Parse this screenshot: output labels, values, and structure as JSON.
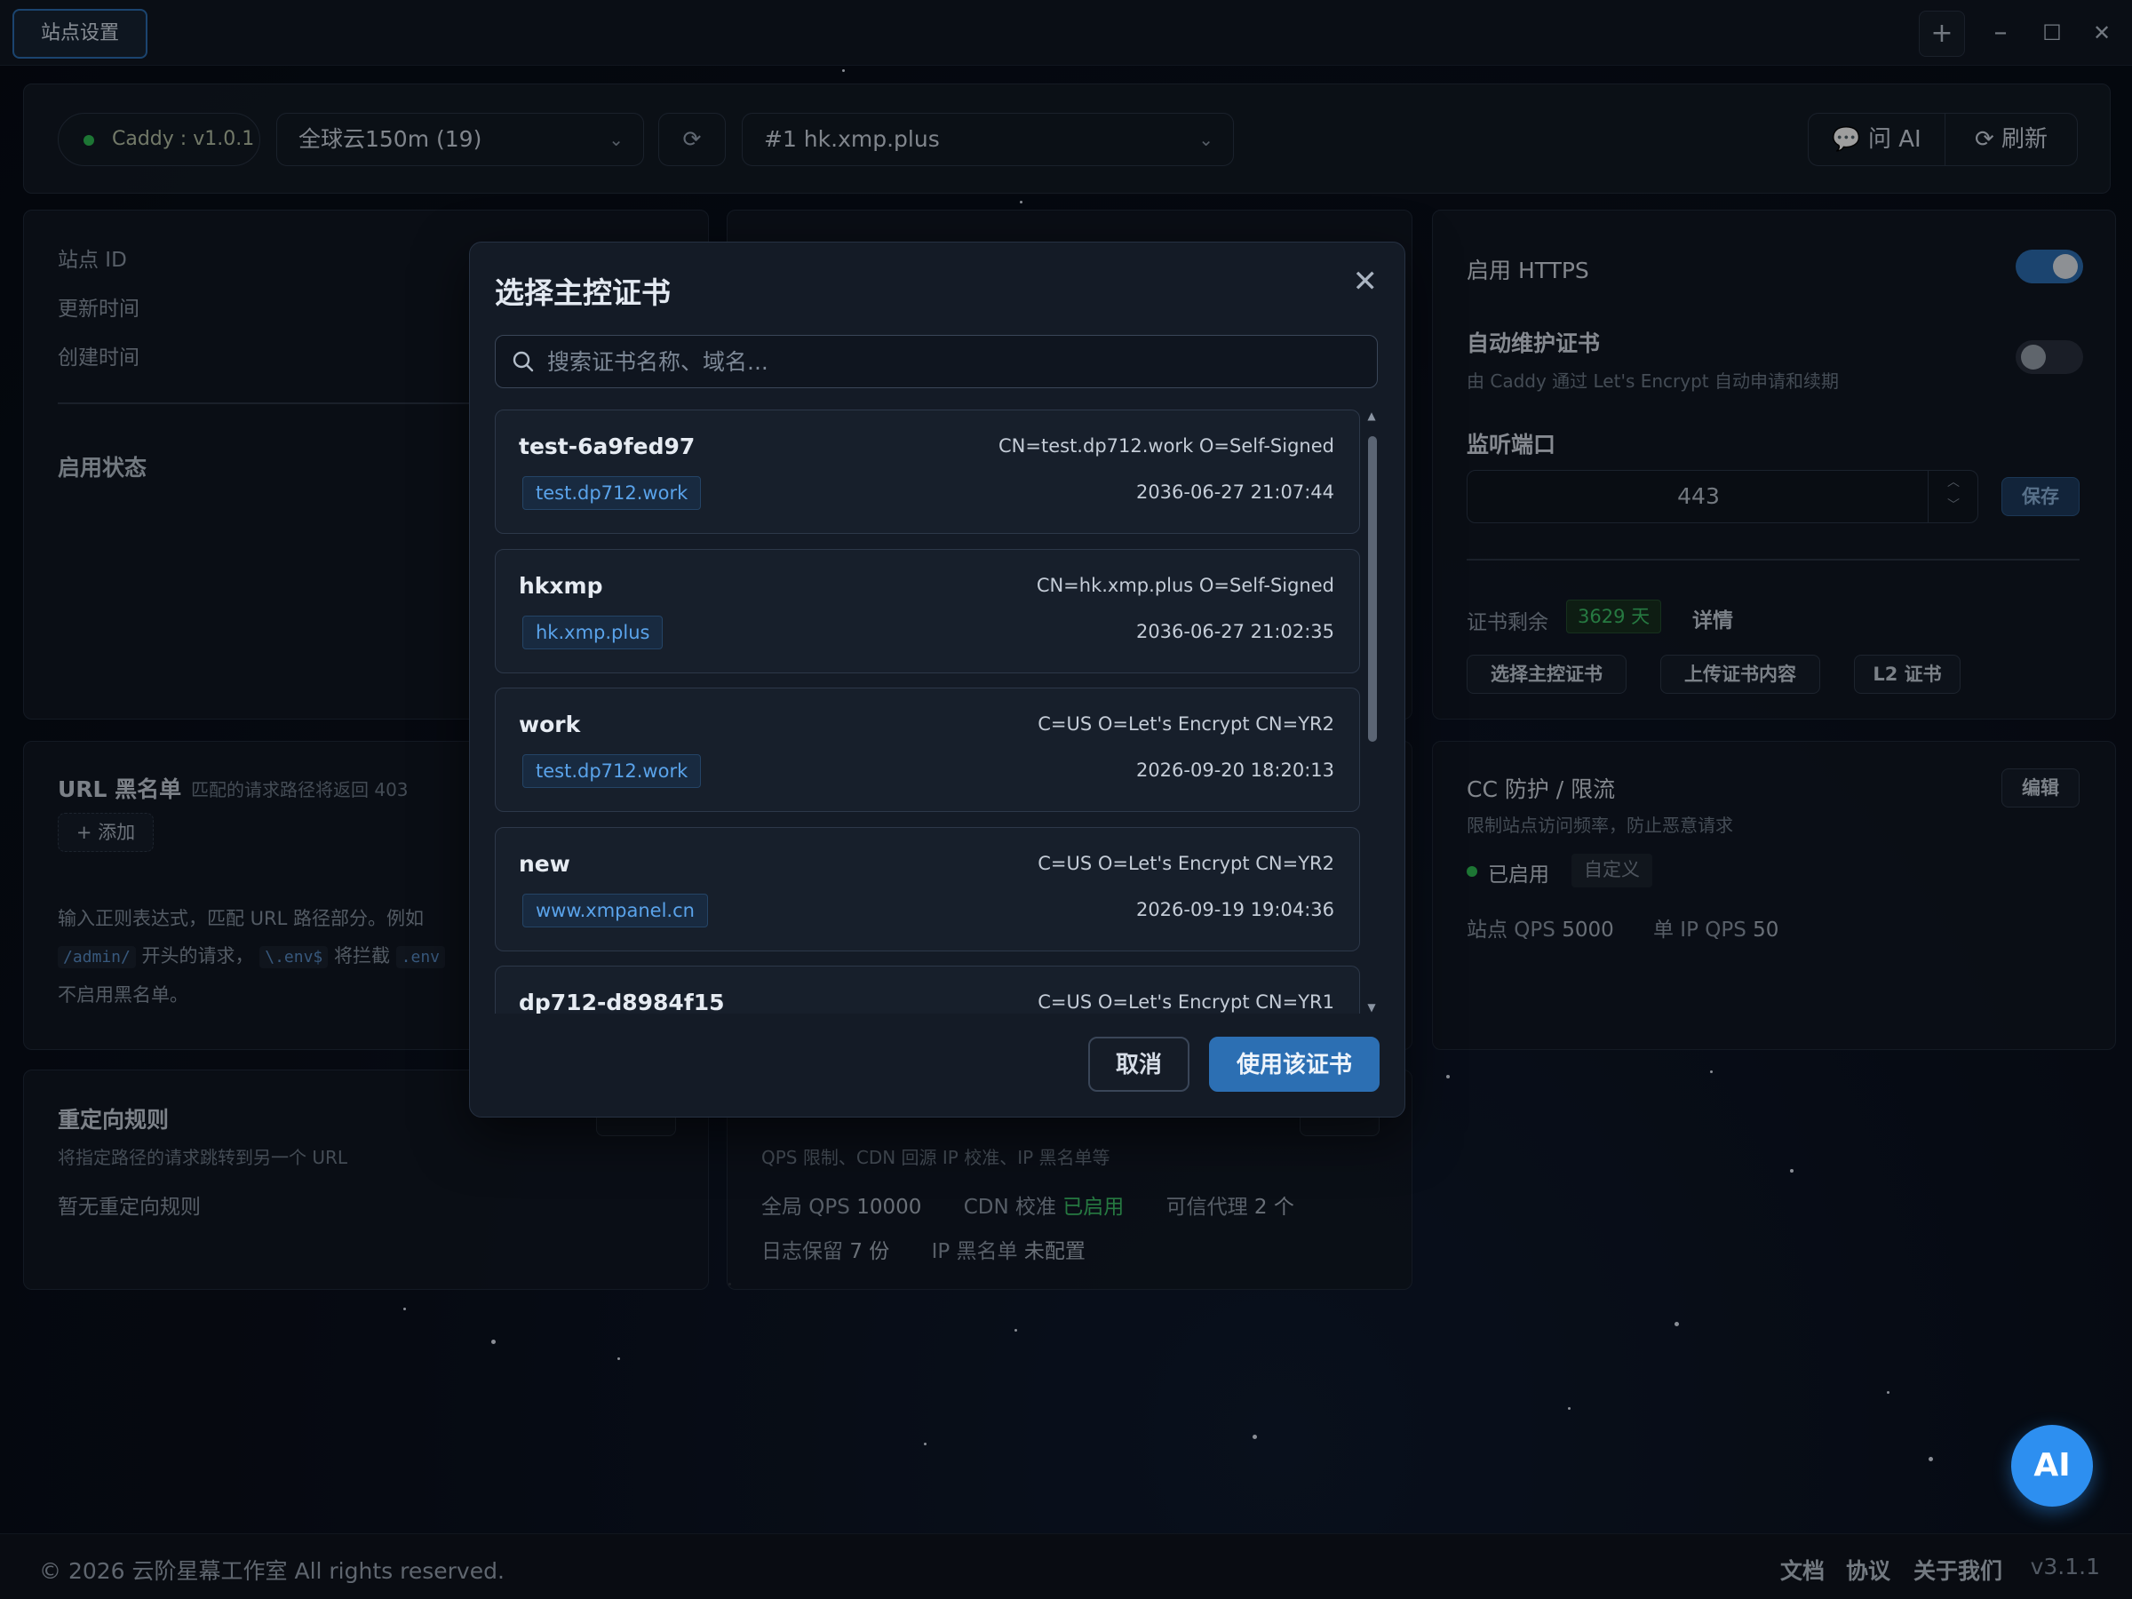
{
  "window": {
    "tab_title": "站点设置",
    "controls": {
      "new": "+",
      "minimize": "–",
      "maximize": "☐",
      "close": "✕"
    }
  },
  "toolbar": {
    "caddy_label": "Caddy : v1.0.1",
    "server_select": "全球云150m (19)",
    "site_select": "#1 hk.xmp.plus",
    "ask_ai": "问 AI",
    "refresh": "刷新"
  },
  "info_card": {
    "site_id_label": "站点 ID",
    "updated_label": "更新时间",
    "created_label": "创建时间",
    "enable_status_label": "启用状态"
  },
  "url_blacklist": {
    "title": "URL 黑名单",
    "subtitle": "匹配的请求路径将返回 403",
    "add_button": "+ 添加",
    "desc_line1": "输入正则表达式，匹配 URL 路径部分。例如",
    "desc_code1": "/admin/",
    "desc_text2": "开头的请求，",
    "desc_code2": "\\.env$",
    "desc_text3": "将拦截",
    "desc_code3": ".env",
    "desc_line3": "不启用黑名单。"
  },
  "redirect": {
    "title": "重定向规则",
    "subtitle": "将指定路径的请求跳转到另一个 URL",
    "empty": "暂无重定向规则"
  },
  "global_card": {
    "subtitle": "QPS 限制、CDN 回源 IP 校准、IP 黑名单等",
    "global_qps_label": "全局 QPS",
    "global_qps_value": "10000",
    "cdn_label": "CDN 校准",
    "cdn_value": "已启用",
    "trusted_label": "可信代理",
    "trusted_value": "2 个",
    "log_label": "日志保留",
    "log_value": "7 份",
    "ipbl_label": "IP 黑名单",
    "ipbl_value": "未配置"
  },
  "https_card": {
    "enable_https_label": "启用 HTTPS",
    "enable_https_on": true,
    "auto_cert_label": "自动维护证书",
    "auto_cert_desc": "由 Caddy 通过 Let's Encrypt 自动申请和续期",
    "auto_cert_on": false,
    "port_label": "监听端口",
    "port_value": "443",
    "save_button": "保存",
    "cert_remaining_label": "证书剩余",
    "cert_remaining_value": "3629 天",
    "details_link": "详情",
    "select_master_button": "选择主控证书",
    "upload_button": "上传证书内容",
    "l2_button": "L2 证书"
  },
  "cc_card": {
    "title": "CC 防护 / 限流",
    "edit_button": "编辑",
    "subtitle": "限制站点访问频率，防止恶意请求",
    "status": "已启用",
    "mode_badge": "自定义",
    "site_qps_label": "站点 QPS",
    "site_qps_value": "5000",
    "ip_qps_label": "单 IP QPS",
    "ip_qps_value": "50"
  },
  "modal": {
    "title": "选择主控证书",
    "search_placeholder": "搜索证书名称、域名...",
    "certs": [
      {
        "name": "test-6a9fed97",
        "subject": "CN=test.dp712.work O=Self-Signed",
        "domain": "test.dp712.work",
        "expires": "2036-06-27 21:07:44"
      },
      {
        "name": "hkxmp",
        "subject": "CN=hk.xmp.plus O=Self-Signed",
        "domain": "hk.xmp.plus",
        "expires": "2036-06-27 21:02:35"
      },
      {
        "name": "work",
        "subject": "C=US O=Let's Encrypt CN=YR2",
        "domain": "test.dp712.work",
        "expires": "2026-09-20 18:20:13"
      },
      {
        "name": "new",
        "subject": "C=US O=Let's Encrypt CN=YR2",
        "domain": "www.xmpanel.cn",
        "expires": "2026-09-19 19:04:36"
      },
      {
        "name": "dp712-d8984f15",
        "subject": "C=US O=Let's Encrypt CN=YR1",
        "domain": "",
        "expires": ""
      }
    ],
    "cancel_button": "取消",
    "use_button": "使用该证书"
  },
  "footer": {
    "copyright": "© 2026 云阶星幕工作室 All rights reserved.",
    "docs": "文档",
    "protocol": "协议",
    "about": "关于我们",
    "version": "v3.1.1"
  },
  "ai_button": "AI",
  "colors": {
    "accent": "#2c6fb3",
    "success": "#2fbf55",
    "link": "#5aa3ea"
  }
}
